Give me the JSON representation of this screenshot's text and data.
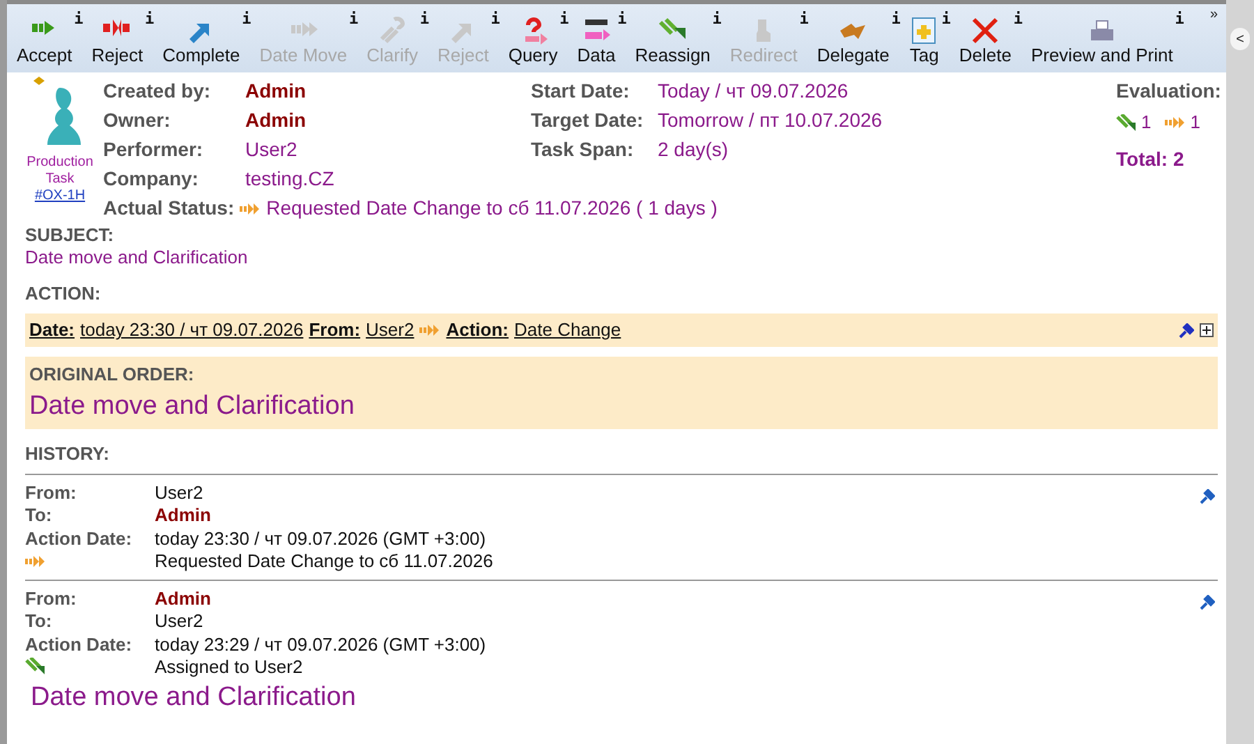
{
  "toolbar": {
    "buttons": [
      {
        "label": "Accept",
        "info": "i",
        "disabled": false,
        "kind": "accept"
      },
      {
        "label": "Reject",
        "info": "i",
        "disabled": false,
        "kind": "reject"
      },
      {
        "label": "Complete",
        "info": "i",
        "disabled": false,
        "kind": "complete"
      },
      {
        "label": "Date Move",
        "info": "i",
        "disabled": true,
        "kind": "move"
      },
      {
        "label": "Clarify",
        "info": "i",
        "disabled": true,
        "kind": "clarify"
      },
      {
        "label": "Reject",
        "info": "i",
        "disabled": true,
        "kind": "complete"
      },
      {
        "label": "Query",
        "info": "i",
        "disabled": false,
        "kind": "query"
      },
      {
        "label": "Data",
        "info": "i",
        "disabled": false,
        "kind": "data"
      },
      {
        "label": "Reassign",
        "info": "i",
        "disabled": false,
        "kind": "reassign"
      },
      {
        "label": "Redirect",
        "info": "i",
        "disabled": true,
        "kind": "redirect"
      },
      {
        "label": "Delegate",
        "info": "i",
        "disabled": false,
        "kind": "delegate"
      },
      {
        "label": "Tag",
        "info": "i",
        "disabled": false,
        "kind": "tag"
      },
      {
        "label": "Delete",
        "info": "i",
        "disabled": false,
        "kind": "delete"
      },
      {
        "label": "Preview and Print",
        "info": "i",
        "disabled": false,
        "kind": "print"
      }
    ],
    "overflow": "»",
    "collapse": "<"
  },
  "task": {
    "type_label": "Production Task",
    "code": "#OX-1H",
    "fields": [
      {
        "label": "Created by:",
        "value": "Admin",
        "kind": "user"
      },
      {
        "label": "Owner:",
        "value": "Admin",
        "kind": "user"
      },
      {
        "label": "Performer:",
        "value": "User2",
        "kind": "plain"
      },
      {
        "label": "Company:",
        "value": "testing.CZ",
        "kind": "plain"
      }
    ],
    "dates": [
      {
        "label": "Start Date:",
        "value": "Today / чт 09.07.2026"
      },
      {
        "label": "Target Date:",
        "value": "Tomorrow / пт 10.07.2026"
      },
      {
        "label": "Task Span:",
        "value": "2 day(s)"
      }
    ],
    "status": {
      "label": "Actual Status:",
      "value": "Requested Date Change to сб 11.07.2026 ( 1 days )"
    },
    "evaluation": {
      "title": "Evaluation:",
      "accepted": "1",
      "moved": "1",
      "total": "Total: 2"
    }
  },
  "subject": {
    "title": "SUBJECT:",
    "text": "Date move and Clarification"
  },
  "action": {
    "title": "ACTION:",
    "date_label": "Date:",
    "date": "today 23:30 / чт 09.07.2026",
    "from_label": "From:",
    "from": "User2",
    "action_label": "Action:",
    "action": "Date Change"
  },
  "original_order": {
    "title": "ORIGINAL ORDER:",
    "text": "Date move and Clarification"
  },
  "history": {
    "title": "HISTORY:",
    "entries": [
      {
        "from_label": "From:",
        "from": "User2",
        "from_highlighted": false,
        "to_label": "To:",
        "to": "Admin",
        "to_highlighted": true,
        "date_label": "Action Date:",
        "date": "today 23:30 / чт 09.07.2026 (GMT +3:00)",
        "kind": "move",
        "note": "Requested Date Change to сб 11.07.2026"
      },
      {
        "from_label": "From:",
        "from": "Admin",
        "from_highlighted": true,
        "to_label": "To:",
        "to": "User2",
        "to_highlighted": false,
        "date_label": "Action Date:",
        "date": "today 23:29 / чт 09.07.2026 (GMT +3:00)",
        "kind": "assign",
        "note": "Assigned to User2"
      }
    ],
    "footer": "Date move and Clarification"
  }
}
